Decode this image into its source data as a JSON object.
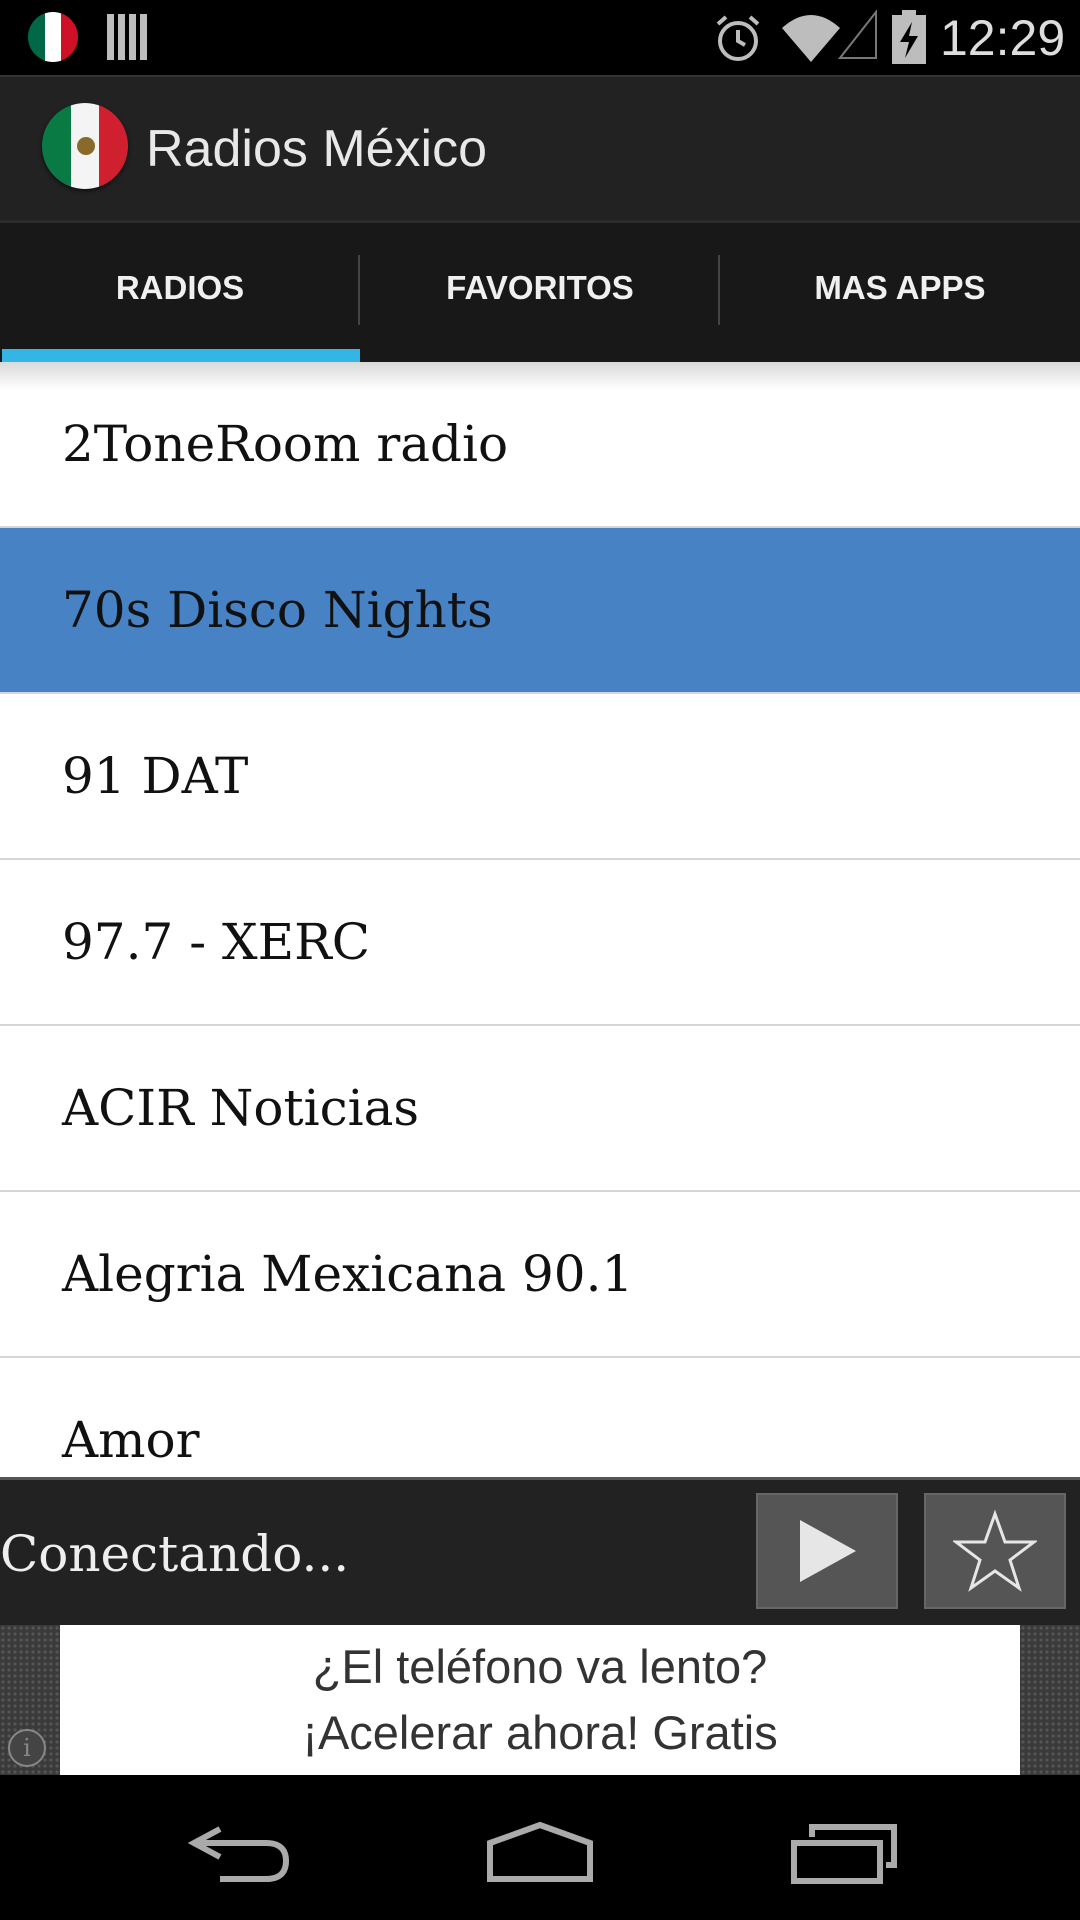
{
  "status_bar": {
    "time": "12:29",
    "icons": [
      "mexico-flag-icon",
      "barcode-icon",
      "alarm-icon",
      "wifi-icon",
      "cell-signal-icon",
      "battery-charging-icon"
    ]
  },
  "action_bar": {
    "title": "Radios México",
    "icon": "radio-mexico-app-icon"
  },
  "tabs": [
    {
      "label": "RADIOS",
      "selected": true
    },
    {
      "label": "FAVORITOS",
      "selected": false
    },
    {
      "label": "MAS APPS",
      "selected": false
    }
  ],
  "stations": [
    {
      "name": "2ToneRoom radio",
      "selected": false
    },
    {
      "name": "70s Disco Nights",
      "selected": true
    },
    {
      "name": "91 DAT",
      "selected": false
    },
    {
      "name": "97.7 - XERC",
      "selected": false
    },
    {
      "name": "ACIR Noticias",
      "selected": false
    },
    {
      "name": "Alegria Mexicana 90.1",
      "selected": false
    },
    {
      "name": "Amor",
      "selected": false
    }
  ],
  "player": {
    "status": "Conectando...",
    "play_icon": "play-icon",
    "favorite_icon": "star-icon"
  },
  "ad": {
    "line1": "¿El teléfono va lento?",
    "line2": "¡Acelerar ahora! Gratis",
    "info_glyph": "i"
  },
  "colors": {
    "tab_indicator": "#33b5e5",
    "selected_row": "#4682c4",
    "action_bar": "#222222"
  }
}
